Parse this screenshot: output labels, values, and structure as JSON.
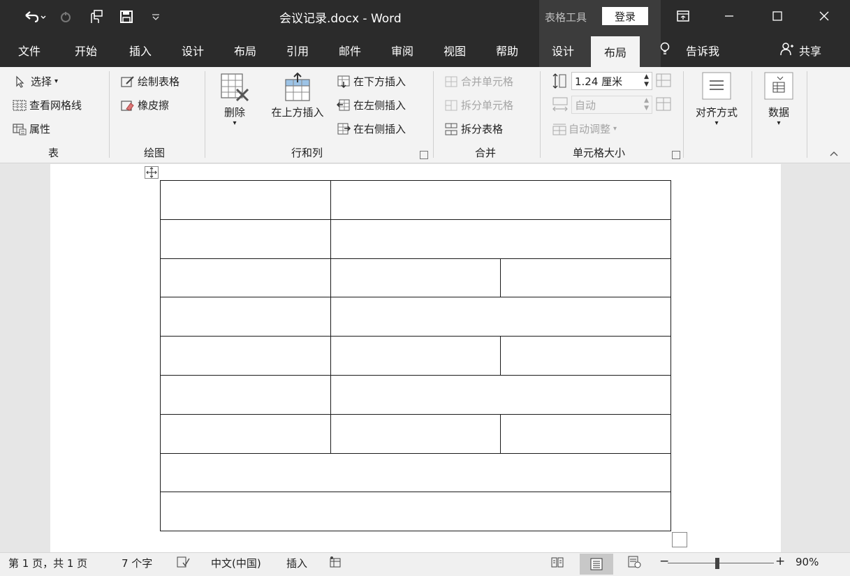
{
  "window": {
    "title": "会议记录.docx  -  Word",
    "context_tab_group": "表格工具",
    "login_label": "登录"
  },
  "tabs": {
    "file": "文件",
    "home": "开始",
    "insert": "插入",
    "design": "设计",
    "layout": "布局",
    "references": "引用",
    "mailings": "邮件",
    "review": "审阅",
    "view": "视图",
    "help": "帮助",
    "table_design": "设计",
    "table_layout": "布局",
    "tell_me": "告诉我",
    "share": "共享"
  },
  "ribbon": {
    "table_group": {
      "select": "选择",
      "view_gridlines": "查看网格线",
      "properties": "属性",
      "label": "表"
    },
    "draw_group": {
      "draw_table": "绘制表格",
      "eraser": "橡皮擦",
      "label": "绘图"
    },
    "rows_cols_group": {
      "delete": "删除",
      "insert_above": "在上方插入",
      "insert_below": "在下方插入",
      "insert_left": "在左侧插入",
      "insert_right": "在右侧插入",
      "label": "行和列"
    },
    "merge_group": {
      "merge_cells": "合并单元格",
      "split_cells": "拆分单元格",
      "split_table": "拆分表格",
      "label": "合并"
    },
    "cell_size_group": {
      "height_value": "1.24 厘米",
      "width_value": "自动",
      "autofit": "自动调整",
      "label": "单元格大小"
    },
    "alignment": "对齐方式",
    "data": "数据"
  },
  "document": {
    "table_rows": [
      {
        "cells": 2
      },
      {
        "cells": 2
      },
      {
        "cells": 3
      },
      {
        "cells": 2
      },
      {
        "cells": 3
      },
      {
        "cells": 2
      },
      {
        "cells": 3
      },
      {
        "cells": 1
      },
      {
        "cells": 1
      }
    ]
  },
  "status": {
    "page": "第 1 页，共 1 页",
    "word_count": "7 个字",
    "language": "中文(中国)",
    "insert_mode": "插入",
    "zoom_level": "90%"
  }
}
